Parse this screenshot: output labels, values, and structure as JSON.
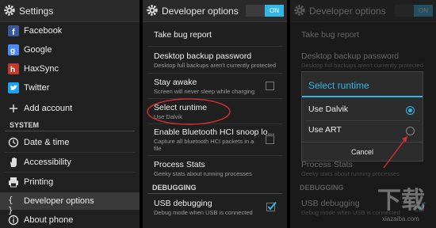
{
  "settings": {
    "title": "Settings",
    "items": [
      {
        "label": "Facebook",
        "icon": "facebook-icon"
      },
      {
        "label": "Google",
        "icon": "google-icon"
      },
      {
        "label": "HaxSync",
        "icon": "haxsync-icon"
      },
      {
        "label": "Twitter",
        "icon": "twitter-icon"
      },
      {
        "label": "Add account",
        "icon": "plus-icon"
      }
    ],
    "system_header": "SYSTEM",
    "system_items": [
      {
        "label": "Date & time",
        "icon": "clock-icon"
      },
      {
        "label": "Accessibility",
        "icon": "hand-icon"
      },
      {
        "label": "Printing",
        "icon": "printer-icon"
      },
      {
        "label": "Developer options",
        "icon": "braces-icon"
      },
      {
        "label": "About phone",
        "icon": "info-icon"
      }
    ]
  },
  "developer": {
    "title": "Developer options",
    "toggle": "ON",
    "items": [
      {
        "title": "Take bug report",
        "summary": ""
      },
      {
        "title": "Desktop backup password",
        "summary": "Desktop full backups aren't currently protected"
      },
      {
        "title": "Stay awake",
        "summary": "Screen will never sleep while charging"
      },
      {
        "title": "Select runtime",
        "summary": "Use Dalvik"
      },
      {
        "title": "Enable Bluetooth HCI snoop lo...",
        "summary": "Capture all bluetooth HCI packets in a",
        "summary2": "file"
      },
      {
        "title": "Process Stats",
        "summary": "Geeky stats about running processes"
      }
    ],
    "debug_header": "DEBUGGING",
    "usb": {
      "title": "USB debugging",
      "summary": "Debug mode when USB is connected"
    }
  },
  "dialog": {
    "title": "Select runtime",
    "options": [
      "Use Dalvik",
      "Use ART"
    ],
    "selected": 0,
    "cancel": "Cancel"
  },
  "watermark": "xiazaiba.com",
  "colors": {
    "accent": "#33b5e5",
    "annotation": "#d32f2f"
  }
}
